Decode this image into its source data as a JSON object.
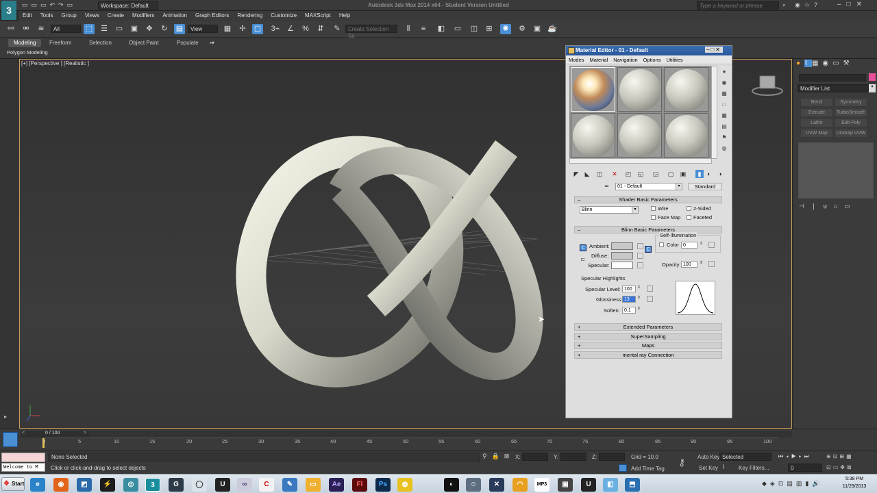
{
  "title_bar": {
    "app_title": "Autodesk 3ds Max  2014 x64  - Student Version   Untitled",
    "workspace_label": "Workspace: Default",
    "search_placeholder": "Type a keyword or phrase"
  },
  "menu": [
    "Edit",
    "Tools",
    "Group",
    "Views",
    "Create",
    "Modifiers",
    "Animation",
    "Graph Editors",
    "Rendering",
    "Customize",
    "MAXScript",
    "Help"
  ],
  "toolbar": {
    "selection_filter": "All",
    "ref_coord": "View",
    "named_selection_placeholder": "Create Selection Se"
  },
  "ribbon": {
    "tabs": [
      "Modeling",
      "Freeform",
      "Selection",
      "Object Paint",
      "Populate"
    ],
    "active_tab": "Modeling",
    "sub_label": "Polygon Modeling"
  },
  "viewport": {
    "label": "[+] [Perspective ] [Realistic ]"
  },
  "material_editor": {
    "title": "Material Editor - 01 - Default",
    "menu": [
      "Modes",
      "Material",
      "Navigation",
      "Options",
      "Utilities"
    ],
    "material_name": "01 - Default",
    "material_type": "Standard",
    "shader_rollout": "Shader Basic Parameters",
    "shader": "Blinn",
    "shader_options": [
      "Wire",
      "2-Sided",
      "Face Map",
      "Faceted"
    ],
    "blinn_rollout": "Blinn Basic Parameters",
    "self_illum_label": "Self-Illumination",
    "color_label": "Color",
    "color_value": "0",
    "ambient_label": "Ambient:",
    "diffuse_label": "Diffuse:",
    "specular_label": "Specular:",
    "opacity_label": "Opacity:",
    "opacity_value": "100",
    "highlights_label": "Specular Highlights",
    "spec_level_label": "Specular Level:",
    "spec_level_value": "100",
    "glossiness_label": "Glossiness:",
    "glossiness_value": "13",
    "soften_label": "Soften:",
    "soften_value": "0.1",
    "rollouts": [
      "Extended Parameters",
      "SuperSampling",
      "Maps",
      "mental ray Connection"
    ],
    "colors": {
      "ambient": "#c8c8c8",
      "diffuse": "#c8c8c8",
      "specular": "#ffffff"
    }
  },
  "command_panel": {
    "modifier_list": "Modifier List",
    "modifiers": [
      "Bend",
      "Symmetry",
      "Extrude",
      "TurboSmooth",
      "Lathe",
      "Edit Poly",
      "UVW Map",
      "Unwrap UVW"
    ],
    "color_swatch": "#e8509a"
  },
  "timeline": {
    "frame_counter": "0 / 100",
    "ticks": [
      "0",
      "5",
      "10",
      "15",
      "20",
      "25",
      "30",
      "35",
      "40",
      "45",
      "50",
      "55",
      "60",
      "65",
      "70",
      "75",
      "80",
      "85",
      "90",
      "95",
      "100"
    ]
  },
  "status": {
    "selection": "None Selected",
    "prompt": "Click or click-and-drag to select objects",
    "welcome": "Welcome to M",
    "x_label": "X:",
    "y_label": "Y:",
    "z_label": "Z:",
    "grid": "Grid = 10.0",
    "add_time_tag": "Add Time Tag",
    "auto_key": "Auto Key",
    "auto_key_value": "Selected",
    "set_key": "Set Key",
    "key_filters": "Key Filters...",
    "frame_field": "0"
  },
  "taskbar": {
    "start": "Start",
    "time": "5:38 PM",
    "date": "11/29/2013"
  }
}
